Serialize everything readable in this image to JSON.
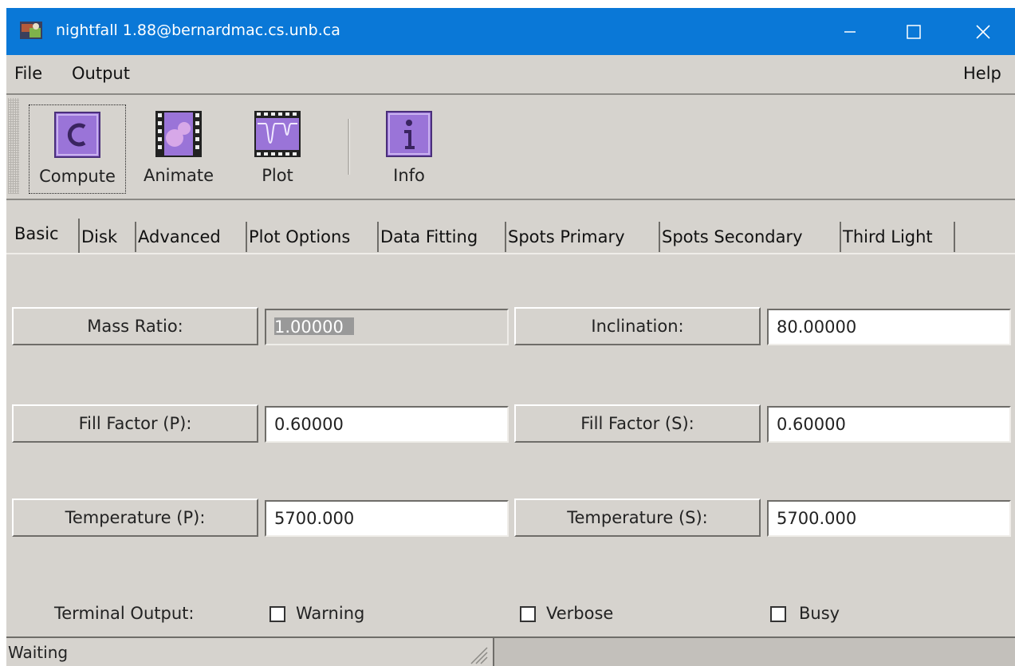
{
  "window": {
    "title": "nightfall  1.88@bernardmac.cs.unb.ca",
    "icons": {
      "app": "nightfall-app-icon",
      "minimize": "minimize-icon",
      "maximize": "maximize-icon",
      "close": "close-icon"
    }
  },
  "menubar": {
    "file": "File",
    "output": "Output",
    "help": "Help"
  },
  "toolbar": {
    "compute": "Compute",
    "animate": "Animate",
    "plot": "Plot",
    "info": "Info"
  },
  "tabs": [
    {
      "label": "Basic",
      "active": true
    },
    {
      "label": "Disk"
    },
    {
      "label": "Advanced"
    },
    {
      "label": "Plot Options"
    },
    {
      "label": "Data Fitting"
    },
    {
      "label": "Spots Primary"
    },
    {
      "label": "Spots Secondary"
    },
    {
      "label": "Third Light"
    }
  ],
  "form": {
    "mass_ratio": {
      "label": "Mass Ratio:",
      "value": "1.00000"
    },
    "inclination": {
      "label": "Inclination:",
      "value": "80.00000"
    },
    "fill_factor_p": {
      "label": "Fill Factor (P):",
      "value": "0.60000"
    },
    "fill_factor_s": {
      "label": "Fill Factor (S):",
      "value": "0.60000"
    },
    "temperature_p": {
      "label": "Temperature (P):",
      "value": "5700.000"
    },
    "temperature_s": {
      "label": "Temperature (S):",
      "value": "5700.000"
    },
    "terminal_output": {
      "label": "Terminal Output:",
      "warning": {
        "label": "Warning",
        "checked": false
      },
      "verbose": {
        "label": "Verbose",
        "checked": false
      },
      "busy": {
        "label": "Busy",
        "checked": false
      }
    }
  },
  "status": {
    "text": "Waiting"
  },
  "colors": {
    "titlebar": "#0a78d7",
    "window_bg": "#d6d3ce",
    "icon_purple": "#9a74d8"
  }
}
